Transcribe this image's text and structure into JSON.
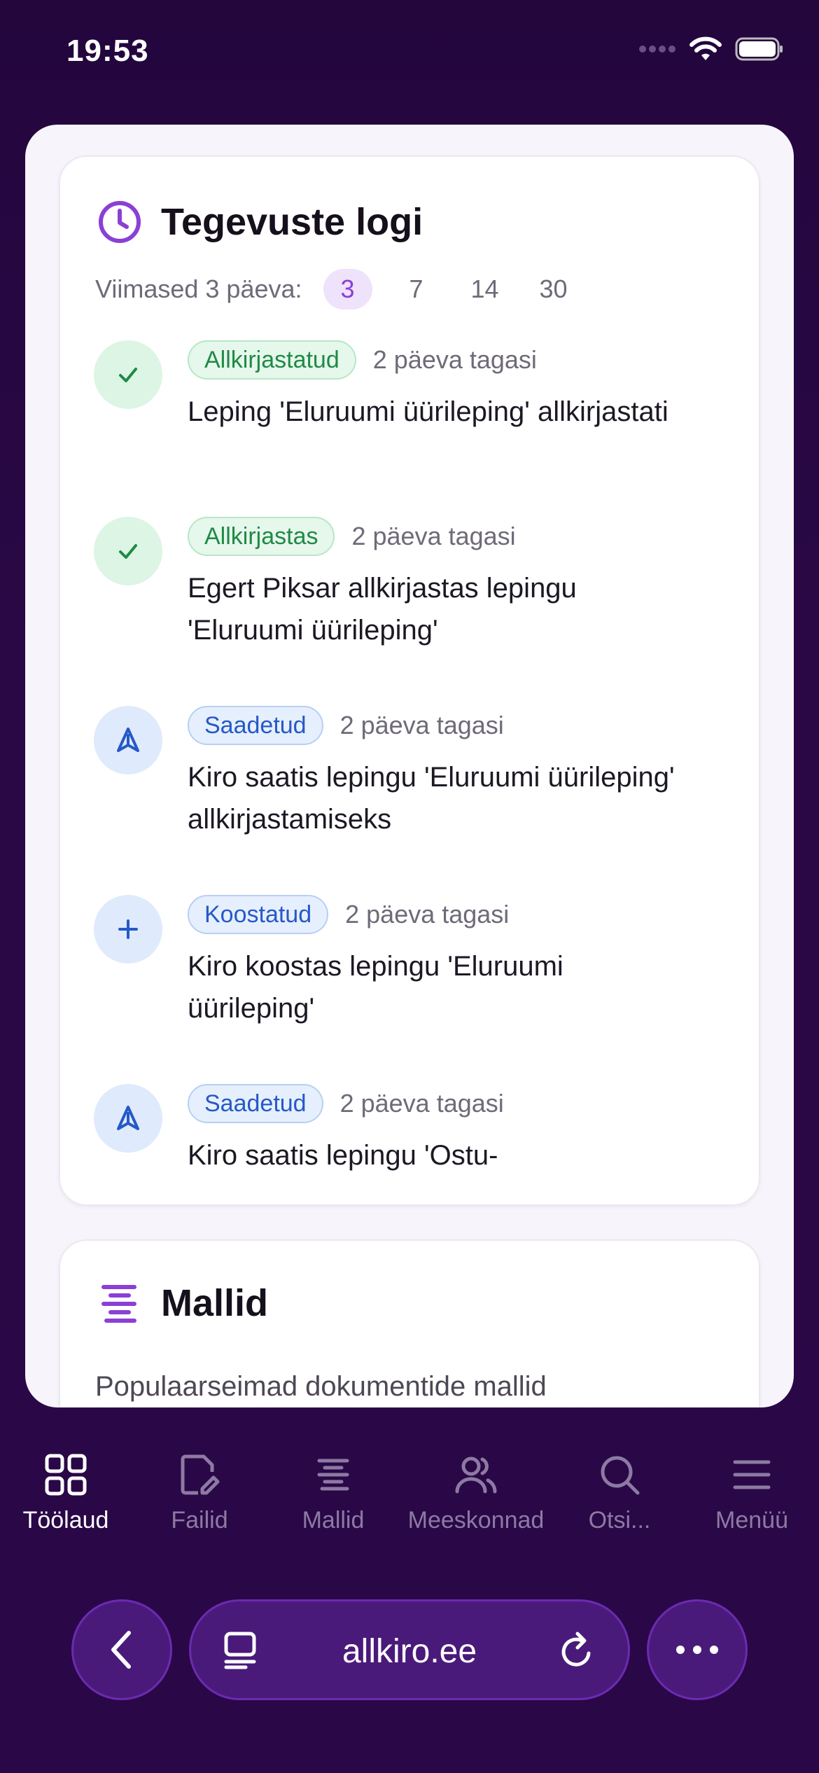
{
  "status_bar": {
    "time": "19:53"
  },
  "activity": {
    "title": "Tegevuste logi",
    "filter_label": "Viimased 3 päeva:",
    "filters": [
      "3",
      "7",
      "14",
      "30"
    ],
    "active_filter": "3",
    "entries": [
      {
        "badge": "Allkirjastatud",
        "badge_color": "green",
        "icon": "check-icon",
        "time": "2 päeva tagasi",
        "text": "Leping 'Eluruumi üürileping' allkirjastati"
      },
      {
        "badge": "Allkirjastas",
        "badge_color": "green",
        "icon": "check-icon",
        "time": "2 päeva tagasi",
        "text": "Egert Piksar allkirjastas lepingu 'Eluruumi üürileping'"
      },
      {
        "badge": "Saadetud",
        "badge_color": "blue",
        "icon": "send-icon",
        "time": "2 päeva tagasi",
        "text": "Kiro saatis lepingu 'Eluruumi üürileping' allkirjastamiseks"
      },
      {
        "badge": "Koostatud",
        "badge_color": "blue",
        "icon": "plus-icon",
        "time": "2 päeva tagasi",
        "text": "Kiro koostas lepingu 'Eluruumi üürileping'"
      },
      {
        "badge": "Saadetud",
        "badge_color": "blue",
        "icon": "send-icon",
        "time": "2 päeva tagasi",
        "text": "Kiro saatis lepingu 'Ostu-"
      }
    ]
  },
  "templates": {
    "title": "Mallid",
    "subtitle": "Populaarseimad dokumentide mallid"
  },
  "tabbar": {
    "items": [
      {
        "label": "Töölaud",
        "icon": "grid-icon",
        "active": true
      },
      {
        "label": "Failid",
        "icon": "file-edit-icon",
        "active": false
      },
      {
        "label": "Mallid",
        "icon": "templates-icon",
        "active": false
      },
      {
        "label": "Meeskonnad",
        "icon": "users-icon",
        "active": false
      },
      {
        "label": "Otsi...",
        "icon": "search-icon",
        "active": false
      },
      {
        "label": "Menüü",
        "icon": "menu-icon",
        "active": false
      }
    ]
  },
  "browser": {
    "url": "allkiro.ee"
  },
  "colors": {
    "accent": "#8b3fd6",
    "background": "#2a0846",
    "success": "#1f8a45",
    "info": "#2659c7"
  }
}
